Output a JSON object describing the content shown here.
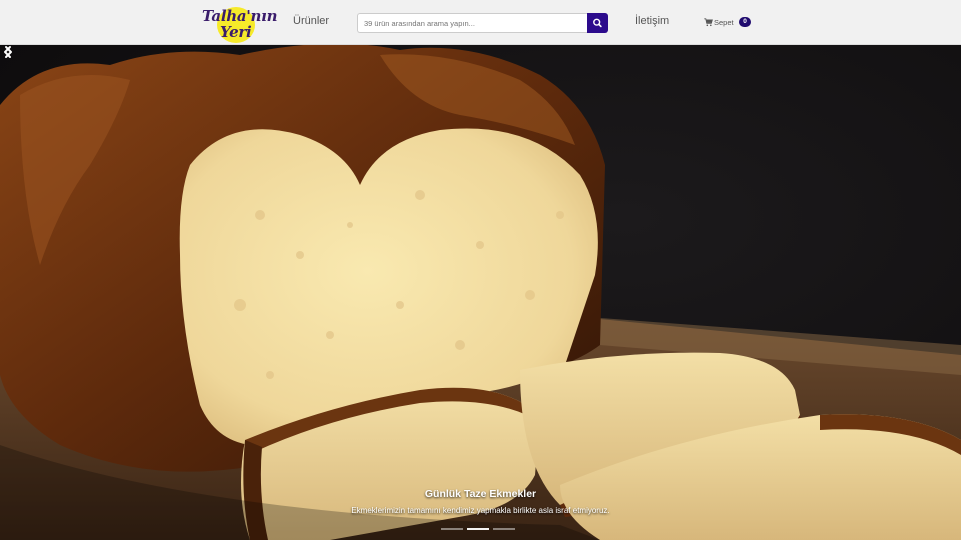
{
  "navbar": {
    "logo_line1": "Talha'nın",
    "logo_line2": "Yeri",
    "products_label": "Ürünler",
    "search_placeholder": "39 ürün arasından arama yapın...",
    "contact_label": "İletişim",
    "cart_label": "Sepet",
    "cart_count": "0",
    "search_icon": "search-icon",
    "cart_icon": "shopping-cart-icon",
    "accent_color": "#2c0b8c"
  },
  "carousel": {
    "slide_title": "Günlük Taze Ekmekler",
    "slide_text": "Ekmeklerimizin tamamını kendimiz yapmakla birlikte asla israf etmiyoruz.",
    "prev_icon": "chevron-left-icon",
    "next_icon": "chevron-right-icon",
    "slide_count": 3,
    "active_slide": 1
  }
}
